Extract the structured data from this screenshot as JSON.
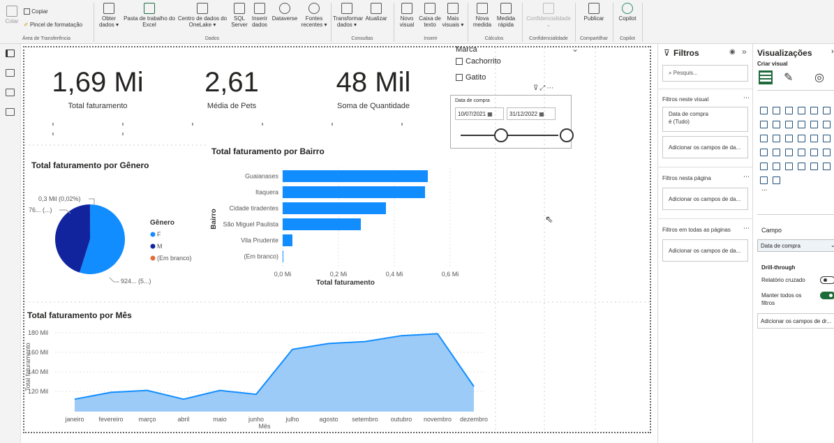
{
  "ribbon": {
    "clipboard": {
      "colar": "Colar",
      "copiar": "Copiar",
      "pincel": "Pincel de formatação",
      "group": "Área de Transferência"
    },
    "dados": {
      "items": [
        {
          "l1": "Obter",
          "l2": "dados ▾"
        },
        {
          "l1": "Pasta de trabalho do",
          "l2": "Excel"
        },
        {
          "l1": "Centro de dados do",
          "l2": "OneLake ▾"
        },
        {
          "l1": "SQL",
          "l2": "Server"
        },
        {
          "l1": "Inserir",
          "l2": "dados"
        },
        {
          "l1": "Dataverse",
          "l2": ""
        },
        {
          "l1": "Fontes",
          "l2": "recentes ▾"
        }
      ],
      "group": "Dados"
    },
    "consultas": {
      "items": [
        {
          "l1": "Transformar",
          "l2": "dados ▾"
        },
        {
          "l1": "Atualizar",
          "l2": ""
        }
      ],
      "group": "Consultas"
    },
    "inserir": {
      "items": [
        {
          "l1": "Novo",
          "l2": "visual"
        },
        {
          "l1": "Caixa de",
          "l2": "texto"
        },
        {
          "l1": "Mais",
          "l2": "visuais ▾"
        }
      ],
      "group": "Inserir"
    },
    "calculos": {
      "items": [
        {
          "l1": "Nova",
          "l2": "medida"
        },
        {
          "l1": "Medida",
          "l2": "rápida"
        }
      ],
      "group": "Cálculos"
    },
    "confidencialidade": {
      "label": "Confidencialidade",
      "group": "Confidencialidade"
    },
    "compartilhar": {
      "label": "Publicar",
      "group": "Compartilhar"
    },
    "copilot": {
      "label": "Copilot",
      "group": "Copilot"
    }
  },
  "kpis": [
    {
      "value": "1,69 Mi",
      "label": "Total faturamento"
    },
    {
      "value": "2,61",
      "label": "Média de Pets"
    },
    {
      "value": "48 Mil",
      "label": "Soma de Quantidade"
    }
  ],
  "slicer_marca": {
    "title": "Marca",
    "options": [
      "Cachorrito",
      "Gatito"
    ]
  },
  "slicer_data": {
    "title": "Data de compra",
    "start": "10/07/2021",
    "end": "31/12/2022"
  },
  "chart_data": [
    {
      "type": "pie",
      "title": "Total faturamento por Gênero",
      "legend_title": "Gênero",
      "categories": [
        "F",
        "M",
        "(Em branco)"
      ],
      "values": [
        924,
        760,
        0.3
      ],
      "colors": [
        "#118dff",
        "#12239e",
        "#e66c37"
      ],
      "data_labels": [
        "924... (5...)",
        "76... (...)",
        "0,3 Mil (0,02%)"
      ]
    },
    {
      "type": "bar",
      "orientation": "horizontal",
      "title": "Total faturamento por Bairro",
      "xlabel": "Total faturamento",
      "ylabel": "Bairro",
      "categories": [
        "Guaianases",
        "Itaquera",
        "Cidade tiradentes",
        "São Miguel Paulista",
        "Vila Prudente",
        "(Em branco)"
      ],
      "values": [
        0.52,
        0.51,
        0.37,
        0.28,
        0.035,
        0.002
      ],
      "xlim": [
        0,
        0.6
      ],
      "xticks": [
        "0,0 Mi",
        "0,2 Mi",
        "0,4 Mi",
        "0,6 Mi"
      ],
      "color": "#118dff"
    },
    {
      "type": "area",
      "title": "Total faturamento por Mês",
      "xlabel": "Mês",
      "ylabel": "Total faturamento",
      "categories": [
        "janeiro",
        "fevereiro",
        "março",
        "abril",
        "maio",
        "junho",
        "julho",
        "agosto",
        "setembro",
        "outubro",
        "novembro",
        "dezembro"
      ],
      "values": [
        112,
        119,
        121,
        112,
        121,
        117,
        163,
        169,
        171,
        177,
        179,
        125
      ],
      "ylim": [
        105,
        185
      ],
      "yticks": [
        "120 Mil",
        "140 Mil",
        "160 Mil",
        "180 Mil"
      ],
      "color": "#118dff"
    }
  ],
  "filters_pane": {
    "title": "Filtros",
    "search_placeholder": "Pesquis...",
    "visual_section": "Filtros neste visual",
    "visual_filter_name": "Data de compra",
    "visual_filter_state": "é (Tudo)",
    "add_fields": "Adicionar os campos de da...",
    "page_section": "Filtros nesta página",
    "all_pages_section": "Filtros em todas as páginas"
  },
  "viz_pane": {
    "title": "Visualizações",
    "build": "Criar visual",
    "more": "...",
    "field_label": "Campo",
    "field_value": "Data de compra",
    "drill_title": "Drill-through",
    "cross_report": "Relatório cruzado",
    "keep_filters": "Manter todos os filtros",
    "add_drill": "Adicionar os campos de dr..."
  }
}
